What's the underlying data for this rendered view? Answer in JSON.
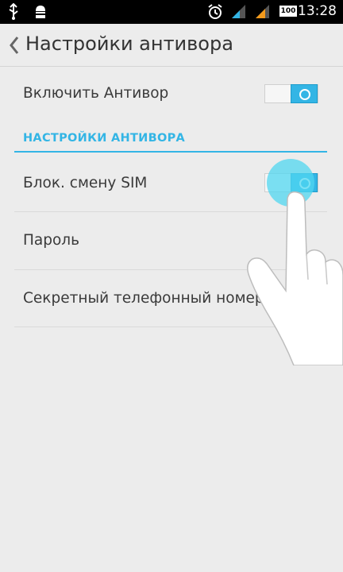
{
  "statusbar": {
    "time": "13:28",
    "battery_level": "100",
    "icons": [
      "usb-icon",
      "android-debug-icon",
      "alarm-icon",
      "signal-icon",
      "signal-icon",
      "battery-icon"
    ]
  },
  "actionbar": {
    "title": "Настройки антивора"
  },
  "settings": {
    "enable_label": "Включить Антивор",
    "enable_on": true,
    "section_header": "НАСТРОЙКИ АНТИВОРА",
    "sim_lock_label": "Блок. смену SIM",
    "sim_lock_on": true,
    "password_label": "Пароль",
    "secret_number_label": "Секретный телефонный номер"
  },
  "colors": {
    "accent": "#33b5e5",
    "background": "#ececec",
    "statusbar": "#000000"
  }
}
